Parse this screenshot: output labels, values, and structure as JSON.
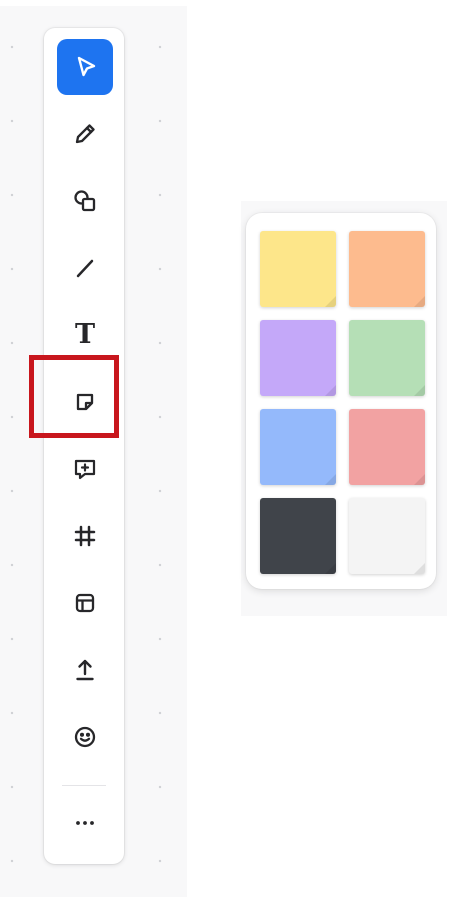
{
  "theme": {
    "accent": "#1e74f0",
    "highlight": "#c8161d"
  },
  "toolbar": {
    "selected_tool": "select",
    "tools": [
      {
        "id": "select",
        "icon": "cursor-arrow-icon"
      },
      {
        "id": "pen",
        "icon": "pencil-icon"
      },
      {
        "id": "shapes",
        "icon": "shapes-icon"
      },
      {
        "id": "line",
        "icon": "line-icon"
      },
      {
        "id": "text",
        "icon": "text-icon"
      },
      {
        "id": "sticky-note",
        "icon": "sticky-note-icon"
      },
      {
        "id": "comment",
        "icon": "comment-add-icon"
      },
      {
        "id": "frame",
        "icon": "frame-icon"
      },
      {
        "id": "template",
        "icon": "layout-template-icon"
      },
      {
        "id": "upload",
        "icon": "upload-icon"
      },
      {
        "id": "emoji",
        "icon": "smiley-face-icon"
      },
      {
        "id": "more",
        "icon": "more-dots-icon"
      }
    ],
    "highlighted_tool": "sticky-note",
    "text_tool_glyph": "T"
  },
  "sticky_palette": {
    "colors": [
      {
        "name": "yellow",
        "hex": "#fde68a"
      },
      {
        "name": "orange",
        "hex": "#fdbb8e"
      },
      {
        "name": "purple",
        "hex": "#c4a8f9"
      },
      {
        "name": "green",
        "hex": "#b5dfb6"
      },
      {
        "name": "blue",
        "hex": "#94b9fb"
      },
      {
        "name": "red",
        "hex": "#f2a2a2"
      },
      {
        "name": "dark",
        "hex": "#40444a"
      },
      {
        "name": "white",
        "hex": "#f4f4f4"
      }
    ]
  }
}
